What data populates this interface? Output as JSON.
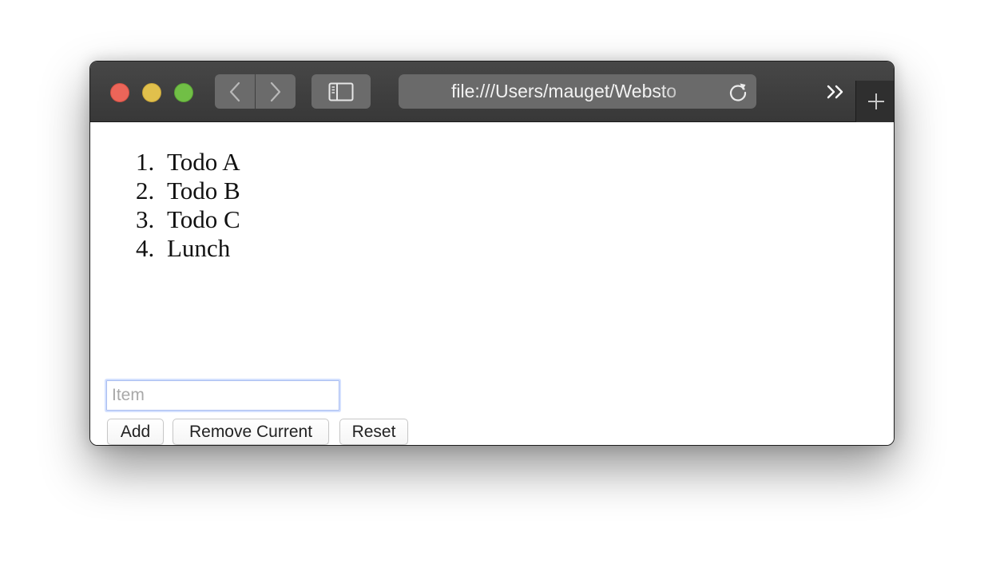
{
  "browser": {
    "address_url": "file:///Users/mauget/Websto",
    "icons": {
      "back": "chevron-left-icon",
      "forward": "chevron-right-icon",
      "sidebar": "sidebar-icon",
      "reload": "reload-icon",
      "overflow": "double-chevron-right-icon",
      "new_tab": "plus-icon"
    }
  },
  "todo": {
    "items": [
      {
        "num": "1.",
        "label": "Todo A"
      },
      {
        "num": "2.",
        "label": "Todo B"
      },
      {
        "num": "3.",
        "label": "Todo C"
      },
      {
        "num": "4.",
        "label": "Lunch"
      }
    ],
    "input": {
      "placeholder": "Item",
      "value": ""
    },
    "buttons": {
      "add": "Add",
      "remove": "Remove Current",
      "reset": "Reset"
    }
  }
}
